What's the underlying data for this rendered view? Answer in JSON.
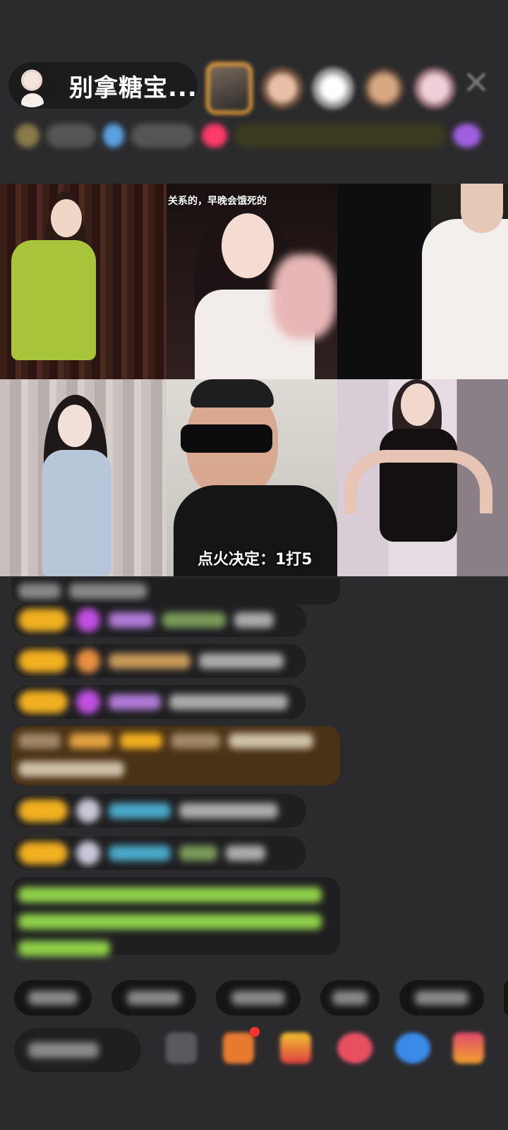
{
  "header": {
    "host_name": "别拿糖宝...",
    "colors": {
      "accent_border": "#f0a43a",
      "pill_bg": "#1c1c1e"
    }
  },
  "viewers": {
    "icons": [
      "viewer-avatar",
      "viewer-avatar",
      "viewer-avatar",
      "viewer-avatar",
      "viewer-avatar"
    ]
  },
  "close_icon": "close-icon",
  "video_grid": {
    "top_caption": "关系的，早晚会饿死的",
    "bottom_caption": "点火决定：1打5"
  },
  "chat": {
    "badge_color": "#f0b020",
    "highlight_bg": "#4a3216",
    "green_text_color": "#8fcf4a"
  },
  "toolbar": {
    "icons": [
      "more-icon",
      "gift-icon",
      "shop-icon",
      "like-icon",
      "share-icon",
      "grid-icon"
    ],
    "notification_color": "#ff3030"
  }
}
